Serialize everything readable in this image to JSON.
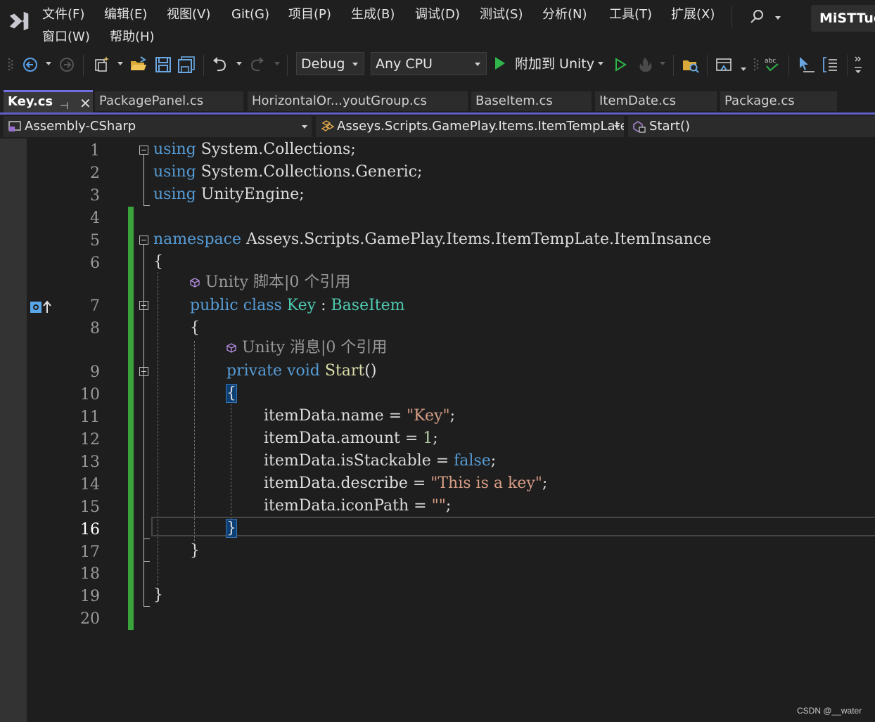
{
  "menu": {
    "items": [
      "文件(F)",
      "编辑(E)",
      "视图(V)",
      "Git(G)",
      "项目(P)",
      "生成(B)",
      "调试(D)",
      "测试(S)",
      "分析(N)",
      "工具(T)",
      "扩展(X)",
      "窗口(W)",
      "帮助(H)"
    ],
    "account": "MiSTTuo"
  },
  "toolbar": {
    "configuration": "Debug",
    "platform": "Any CPU",
    "attach_label": "附加到 Unity"
  },
  "tabs": [
    {
      "label": "Key.cs",
      "active": true
    },
    {
      "label": "PackagePanel.cs"
    },
    {
      "label": "HorizontalOr...youtGroup.cs"
    },
    {
      "label": "BaseItem.cs"
    },
    {
      "label": "ItemDate.cs"
    },
    {
      "label": "Package.cs"
    }
  ],
  "navbar": {
    "project": "Assembly-CSharp",
    "type": "Asseys.Scripts.GamePlay.Items.ItemTempLate",
    "member": "Start()"
  },
  "editor": {
    "line_numbers": [
      "1",
      "2",
      "3",
      "4",
      "5",
      "6",
      "7",
      "8",
      "9",
      "10",
      "11",
      "12",
      "13",
      "14",
      "15",
      "16",
      "17",
      "18",
      "19",
      "20"
    ],
    "current_line": "16",
    "lines": {
      "l1": {
        "kw": "using",
        "rest": " System.Collections;"
      },
      "l2": {
        "kw": "using",
        "rest": " System.Collections.Generic;"
      },
      "l3": {
        "kw": "using",
        "rest": " UnityEngine;"
      },
      "l5": {
        "kw": "namespace",
        "rest": " Asseys.Scripts.GamePlay.Items.ItemTempLate.ItemInsance"
      },
      "l6": "{",
      "l7": {
        "kw1": "public",
        "kw2": "class",
        "type": "Key",
        "colon": " : ",
        "base": "BaseItem"
      },
      "l8": "{",
      "l9": {
        "kw1": "private",
        "kw2": "void",
        "name": "Start",
        "parens": "()"
      },
      "l10": "{",
      "l11": {
        "lhs": "itemData.name = ",
        "str": "\"Key\"",
        "end": ";"
      },
      "l12": {
        "lhs": "itemData.amount = ",
        "num": "1",
        "end": ";"
      },
      "l13": {
        "lhs": "itemData.isStackable = ",
        "kw": "false",
        "end": ";"
      },
      "l14": {
        "lhs": "itemData.describe = ",
        "str": "\"This is a key\"",
        "end": ";"
      },
      "l15": {
        "lhs": "itemData.iconPath = ",
        "str": "\"\"",
        "end": ";"
      },
      "l16": "}",
      "l17": "}",
      "l19": "}"
    },
    "codelens_class": "Unity 脚本|0 个引用",
    "codelens_method": "Unity 消息|0 个引用"
  },
  "watermark": "CSDN @__water",
  "colors": {
    "keyword": "#569cd6",
    "type": "#4ec9b0",
    "string": "#d69d85",
    "change_bar": "#3ba33b",
    "tab_accent": "#5f5fc9"
  }
}
